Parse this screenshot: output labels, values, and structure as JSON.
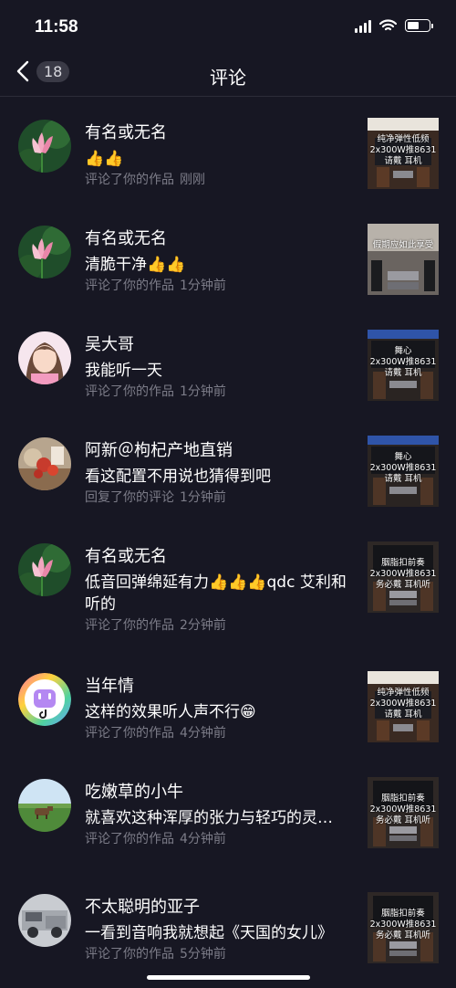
{
  "status": {
    "time": "11:58"
  },
  "header": {
    "back_count": "18",
    "title": "评论"
  },
  "comments": [
    {
      "name": "有名或无名",
      "text": "👍👍",
      "action": "评论了你的作品",
      "when": "刚刚",
      "avatar": "lotus",
      "thumb_text": "纯净弹性低频\n2x300W推8631\n请戴  耳机",
      "thumb": "a"
    },
    {
      "name": "有名或无名",
      "text": "清脆干净👍👍",
      "action": "评论了你的作品",
      "when": "1分钟前",
      "avatar": "lotus",
      "thumb_text": "假期应如此享受",
      "thumb": "b"
    },
    {
      "name": "吴大哥",
      "text": "我能听一天",
      "action": "评论了你的作品",
      "when": "1分钟前",
      "avatar": "girl",
      "thumb_text": "舞心\n2x300W推8631\n请戴  耳机",
      "thumb": "c"
    },
    {
      "name": "阿新＠枸杞产地直销",
      "text": "看这配置不用说也猜得到吧",
      "action": "回复了你的评论",
      "when": "1分钟前",
      "avatar": "berry",
      "thumb_text": "舞心\n2x300W推8631\n请戴  耳机",
      "thumb": "c"
    },
    {
      "name": "有名或无名",
      "text": "低音回弹绵延有力👍👍👍qdc 艾利和听的",
      "action": "评论了你的作品",
      "when": "2分钟前",
      "avatar": "lotus",
      "thumb_text": "胭脂扣前奏\n2x300W推8631\n务必戴  耳机听",
      "thumb": "d"
    },
    {
      "name": "当年情",
      "text": "这样的效果听人声不行😁",
      "action": "评论了你的作品",
      "when": "4分钟前",
      "avatar": "tiktok",
      "thumb_text": "纯净弹性低频\n2x300W推8631\n请戴  耳机",
      "thumb": "a"
    },
    {
      "name": "吃嫩草的小牛",
      "text": "就喜欢这种浑厚的张力与轻巧的灵…",
      "action": "评论了你的作品",
      "when": "4分钟前",
      "avatar": "field",
      "thumb_text": "胭脂扣前奏\n2x300W推8631\n务必戴  耳机听",
      "thumb": "d"
    },
    {
      "name": "不太聪明的亚子",
      "text": "一看到音响我就想起《天国的女儿》",
      "action": "评论了你的作品",
      "when": "5分钟前",
      "avatar": "truck",
      "thumb_text": "胭脂扣前奏\n2x300W推8631\n务必戴  耳机听",
      "thumb": "d"
    }
  ]
}
